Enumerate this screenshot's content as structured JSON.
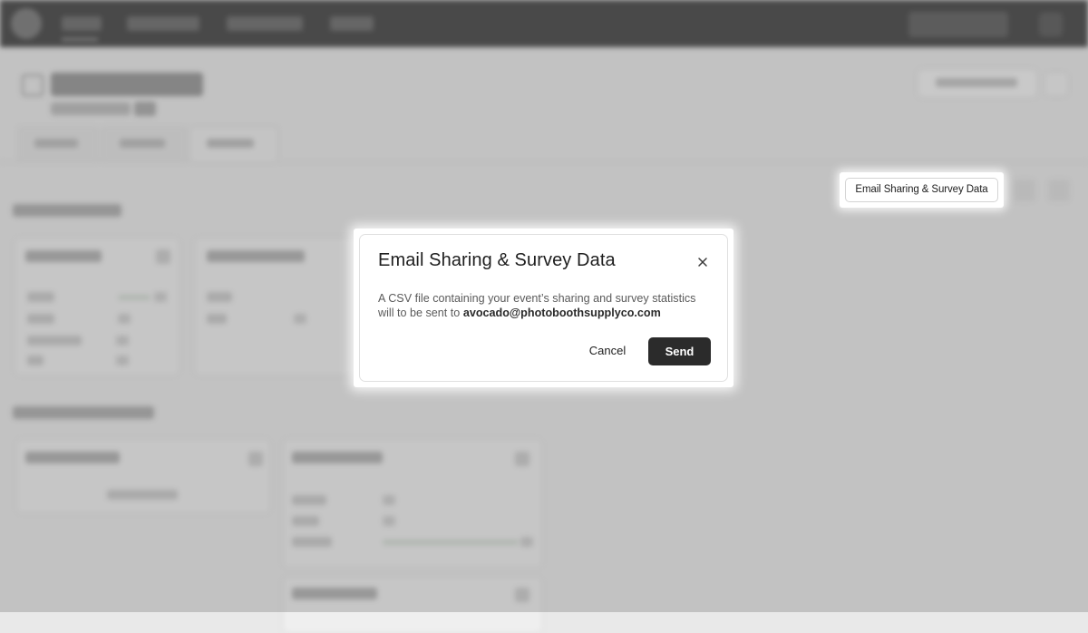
{
  "page": {
    "toolbar_button_label": "Email Sharing & Survey Data"
  },
  "modal": {
    "title": "Email Sharing & Survey Data",
    "body_text": "A CSV file containing your event’s sharing and survey statistics will to be sent to",
    "email": "avocado@photoboothsupplyco.com",
    "cancel_label": "Cancel",
    "send_label": "Send"
  },
  "icons": {
    "close": "close-icon"
  },
  "colors": {
    "send_button_bg": "#2b2b2b",
    "topbar_bg": "#2c2c2c",
    "overlay": "#7d7d7d"
  }
}
